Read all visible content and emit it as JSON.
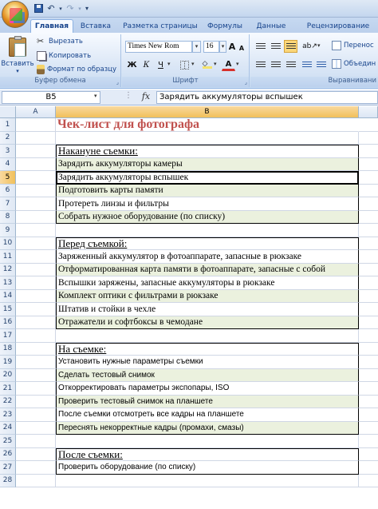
{
  "qat": {
    "undo_icon": "undo-icon",
    "redo_icon": "redo-icon"
  },
  "tabs": [
    "Главная",
    "Вставка",
    "Разметка страницы",
    "Формулы",
    "Данные",
    "Рецензирование"
  ],
  "clipboard": {
    "paste": "Вставить",
    "cut": "Вырезать",
    "copy": "Копировать",
    "format_painter": "Формат по образцу",
    "group_label": "Буфер обмена"
  },
  "font": {
    "font_name": "Times New Rom",
    "font_size": "16",
    "group_label": "Шрифт",
    "bold": "Ж",
    "italic": "К",
    "underline": "Ч",
    "grow": "A",
    "shrink": "A",
    "font_color": "A"
  },
  "alignment": {
    "wrap": "Перенос",
    "merge": "Объедин",
    "group_label": "Выравнивани"
  },
  "formula_bar": {
    "name_box": "B5",
    "fx": "fx",
    "content": "Зарядить аккумуляторы вспышек"
  },
  "columns": [
    "A",
    "B"
  ],
  "rows": [
    {
      "n": "1",
      "text": "Чек-лист для фотографа"
    },
    {
      "n": "2",
      "text": ""
    },
    {
      "n": "3",
      "text": "Накануне съемки:"
    },
    {
      "n": "4",
      "text": "Зарядить аккумуляторы камеры"
    },
    {
      "n": "5",
      "text": "Зарядить аккумуляторы вспышек"
    },
    {
      "n": "6",
      "text": "Подготовить карты памяти"
    },
    {
      "n": "7",
      "text": "Протереть линзы и фильтры"
    },
    {
      "n": "8",
      "text": "Собрать нужное оборудование (по списку)"
    },
    {
      "n": "9",
      "text": ""
    },
    {
      "n": "10",
      "text": "Перед съемкой:"
    },
    {
      "n": "11",
      "text": "Заряженный аккумулятор в фотоаппарате, запасные в рюкзаке"
    },
    {
      "n": "12",
      "text": "Отформатированная карта памяти в фотоаппарате, запасные с собой"
    },
    {
      "n": "13",
      "text": "Вспышки заряжены, запасные аккумуляторы в рюкзаке"
    },
    {
      "n": "14",
      "text": "Комплект оптики с фильтрами в рюкзаке"
    },
    {
      "n": "15",
      "text": "Штатив и стойки в чехле"
    },
    {
      "n": "16",
      "text": "Отражатели и софтбоксы в чемодане"
    },
    {
      "n": "17",
      "text": ""
    },
    {
      "n": "18",
      "text": "На съемке:"
    },
    {
      "n": "19",
      "text": "Установить нужные параметры съемки"
    },
    {
      "n": "20",
      "text": "Сделать тестовый снимок"
    },
    {
      "n": "21",
      "text": "Откорректировать параметры экспопары, ISO"
    },
    {
      "n": "22",
      "text": "Проверить тестовый снимок на планшете"
    },
    {
      "n": "23",
      "text": "После съемки отсмотреть все кадры на планшете"
    },
    {
      "n": "24",
      "text": "Переснять некорректные кадры (промахи, смазы)"
    },
    {
      "n": "25",
      "text": ""
    },
    {
      "n": "26",
      "text": "После съемки:"
    },
    {
      "n": "27",
      "text": "Проверить оборудование (по списку)"
    },
    {
      "n": "28",
      "text": ""
    }
  ],
  "colors": {
    "title": "#c0504d",
    "band": "#ebf1de",
    "ribbon": "#dbe7f6"
  }
}
